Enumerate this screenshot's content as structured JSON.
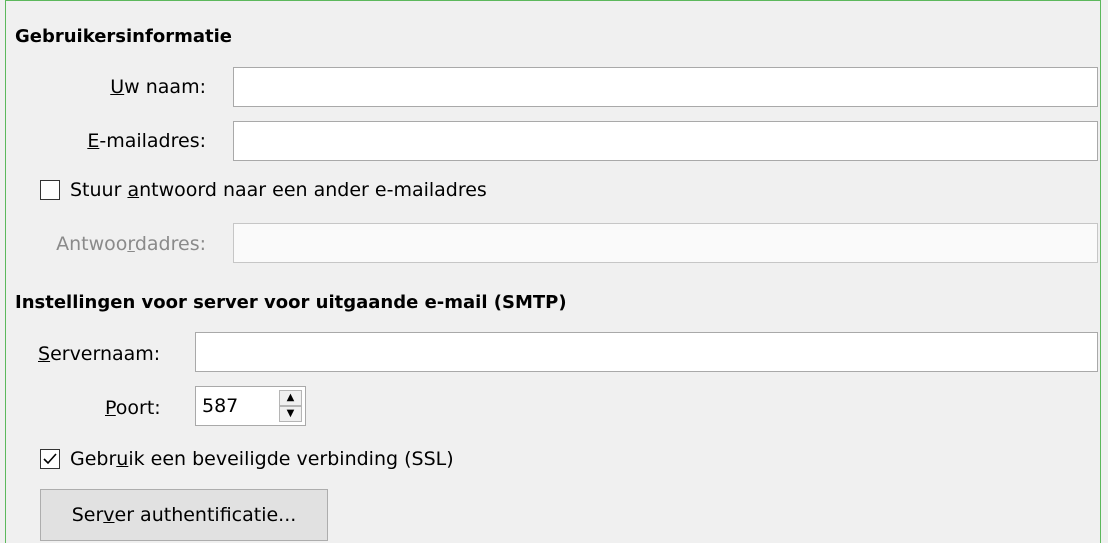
{
  "user_info": {
    "heading": "Gebruikersinformatie",
    "name_label_first": "U",
    "name_label_rest": "w naam:",
    "name_value": "",
    "email_label_first": "E",
    "email_label_rest": "-mailadres:",
    "email_value": "",
    "reply_checkbox_pre": "Stuur ",
    "reply_checkbox_ul": "a",
    "reply_checkbox_post": "ntwoord naar een ander e-mailadres",
    "reply_checked": false,
    "reply_label_pre": "Antwoo",
    "reply_label_ul": "r",
    "reply_label_post": "dadres:",
    "reply_value": ""
  },
  "smtp": {
    "heading": "Instellingen voor server voor uitgaande e-mail (SMTP)",
    "server_label_first": "S",
    "server_label_rest": "ervernaam:",
    "server_value": "",
    "port_label_first": "P",
    "port_label_rest": "oort:",
    "port_value": "587",
    "ssl_pre": "Gebr",
    "ssl_ul": "u",
    "ssl_post": "ik een beveiligde verbinding (SSL)",
    "ssl_checked": true,
    "auth_button_pre": "Ser",
    "auth_button_ul": "v",
    "auth_button_post": "er authentificatie..."
  },
  "icons": {
    "spin_up": "spin-up-icon",
    "spin_down": "spin-down-icon",
    "checkmark": "checkmark-icon"
  }
}
